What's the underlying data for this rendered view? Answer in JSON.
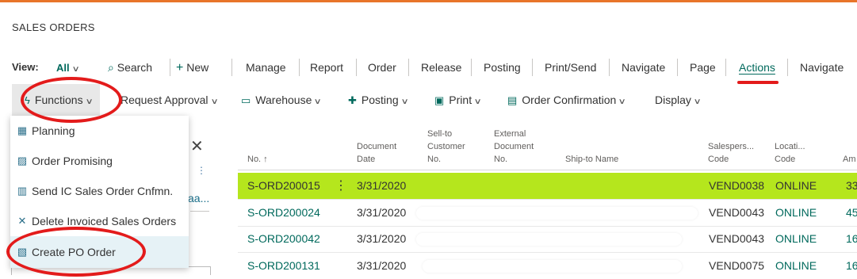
{
  "page": {
    "title": "SALES ORDERS"
  },
  "action_bar": {
    "view_label": "View:",
    "view_value": "All",
    "search": "Search",
    "new": "New",
    "items": [
      "Manage",
      "Report",
      "Order",
      "Release",
      "Posting",
      "Print/Send",
      "Navigate",
      "Page",
      "Actions",
      "Navigate"
    ]
  },
  "sub_bar": {
    "functions": "Functions",
    "request_approval": "Request Approval",
    "warehouse": "Warehouse",
    "posting": "Posting",
    "print": "Print",
    "order_confirmation": "Order Confirmation",
    "display": "Display"
  },
  "menu": {
    "items": [
      {
        "label": "Planning",
        "icon": "planning-icon"
      },
      {
        "label": "Order Promising",
        "icon": "order-promising-icon"
      },
      {
        "label": "Send IC Sales Order Cnfmn.",
        "icon": "send-ic-icon"
      },
      {
        "label": "Delete Invoiced Sales Orders",
        "icon": "delete-x-icon"
      },
      {
        "label": "Create PO Order",
        "icon": "create-po-icon"
      }
    ]
  },
  "left_pane": {
    "truncated_text": "aa..."
  },
  "grid": {
    "headers": {
      "no": "No. ↑",
      "doc_date": [
        "Document",
        "Date"
      ],
      "sell_to": [
        "Sell-to",
        "Customer",
        "No."
      ],
      "external": [
        "External",
        "Document",
        "No."
      ],
      "ship_to": "Ship-to Name",
      "salesperson": [
        "Salespers...",
        "Code"
      ],
      "location": [
        "Locati...",
        "Code"
      ],
      "amount": "Am"
    },
    "rows": [
      {
        "no": "S-ORD200015",
        "date": "3/31/2020",
        "salesperson": "VEND0038",
        "location": "ONLINE",
        "amount": "33"
      },
      {
        "no": "S-ORD200024",
        "date": "3/31/2020",
        "salesperson": "VEND0043",
        "location": "ONLINE",
        "amount": "45"
      },
      {
        "no": "S-ORD200042",
        "date": "3/31/2020",
        "salesperson": "VEND0043",
        "location": "ONLINE",
        "amount": "16"
      },
      {
        "no": "S-ORD200131",
        "date": "3/31/2020",
        "salesperson": "VEND0075",
        "location": "ONLINE",
        "amount": "16"
      }
    ],
    "row_menu": "⋮"
  },
  "colors": {
    "accent": "#00695c",
    "highlight": "#b5e61d",
    "annotation": "#e31b1b",
    "top_bar": "#e8752a"
  }
}
